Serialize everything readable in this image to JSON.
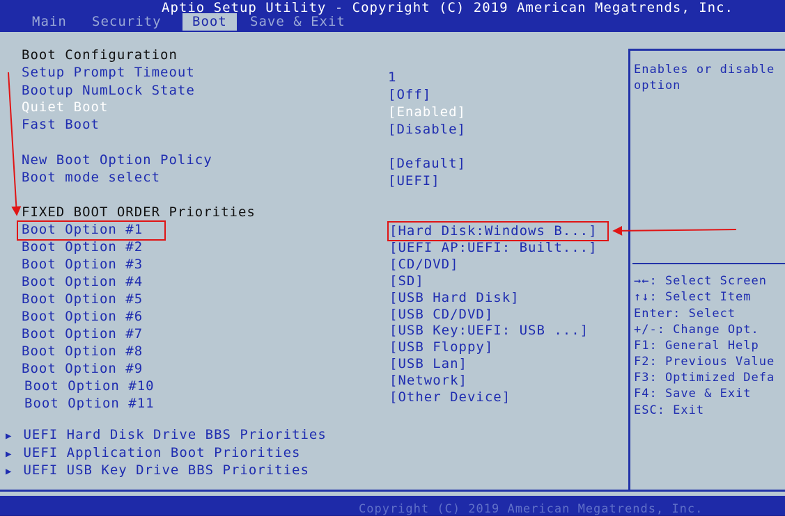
{
  "header": {
    "title": "Aptio Setup Utility - Copyright (C) 2019 American Megatrends, Inc.",
    "tabs": [
      {
        "label": "Main",
        "active": false
      },
      {
        "label": "Security",
        "active": false
      },
      {
        "label": "Boot",
        "active": true
      },
      {
        "label": "Save & Exit",
        "active": false
      }
    ]
  },
  "boot": {
    "section_title": "Boot Configuration",
    "settings": [
      {
        "label": "Setup Prompt Timeout",
        "value": "1"
      },
      {
        "label": "Bootup NumLock State",
        "value": "[Off]"
      },
      {
        "label": "Quiet Boot",
        "value": "[Enabled]"
      },
      {
        "label": "Fast Boot",
        "value": "[Disable]"
      },
      {
        "label": "New Boot Option Policy",
        "value": "[Default]"
      },
      {
        "label": "Boot mode select",
        "value": "[UEFI]"
      }
    ],
    "fixed_order_title": "FIXED BOOT ORDER Priorities",
    "boot_options": [
      {
        "label": "Boot Option #1",
        "value": "[Hard Disk:Windows B...]"
      },
      {
        "label": "Boot Option #2",
        "value": "[UEFI AP:UEFI: Built...]"
      },
      {
        "label": "Boot Option #3",
        "value": "[CD/DVD]"
      },
      {
        "label": "Boot Option #4",
        "value": "[SD]"
      },
      {
        "label": "Boot Option #5",
        "value": "[USB Hard Disk]"
      },
      {
        "label": "Boot Option #6",
        "value": "[USB CD/DVD]"
      },
      {
        "label": "Boot Option #7",
        "value": "[USB Key:UEFI:  USB ...]"
      },
      {
        "label": "Boot Option #8",
        "value": "[USB Floppy]"
      },
      {
        "label": "Boot Option #9",
        "value": "[USB Lan]"
      },
      {
        "label": "Boot Option #10",
        "value": "[Network]"
      },
      {
        "label": "Boot Option #11",
        "value": "[Other Device]"
      }
    ],
    "submenus": [
      "UEFI Hard Disk Drive BBS Priorities",
      "UEFI Application Boot Priorities",
      "UEFI USB Key Drive BBS Priorities"
    ]
  },
  "help_panel": {
    "description_line1": "Enables or disable",
    "description_line2": "option",
    "keys": [
      "→←: Select Screen",
      "↑↓: Select Item",
      "Enter: Select",
      "+/-: Change Opt.",
      "F1: General Help",
      "F2: Previous Value",
      "F3: Optimized Defa",
      "F4: Save & Exit",
      "ESC: Exit"
    ]
  },
  "footer": {
    "text": "Copyright (C) 2019 American Megatrends, Inc."
  },
  "colors": {
    "frame_blue": "#1e2aa8",
    "panel_bg": "#b9c8d2",
    "item_blue": "#1f2db0",
    "annotation_red": "#e01515"
  }
}
